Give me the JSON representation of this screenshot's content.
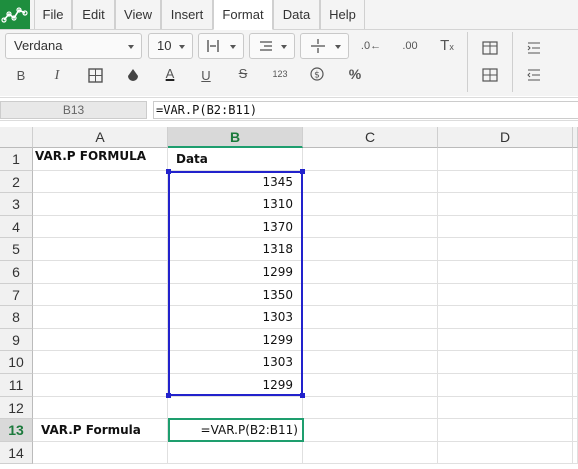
{
  "menu": [
    "File",
    "Edit",
    "View",
    "Insert",
    "Format",
    "Data",
    "Help"
  ],
  "menu_active": "Format",
  "toolbar": {
    "font_name": "Verdana",
    "font_size": "10",
    "bold": "B",
    "italic": "I",
    "text_color_glyph": "A",
    "underline": "U",
    "strike": "S",
    "number_format": "123",
    "percent": "%"
  },
  "name_box": "B13",
  "formula_bar": "=VAR.P(B2:B11)",
  "columns": [
    "A",
    "B",
    "C",
    "D"
  ],
  "rows": [
    "1",
    "2",
    "3",
    "4",
    "5",
    "6",
    "7",
    "8",
    "9",
    "10",
    "11",
    "12",
    "13",
    "14"
  ],
  "cells": {
    "A1": "VAR.P FORMULA",
    "B1": "Data",
    "B2": "1345",
    "B3": "1310",
    "B4": "1370",
    "B5": "1318",
    "B6": "1299",
    "B7": "1350",
    "B8": "1303",
    "B9": "1299",
    "B10": "1303",
    "B11": "1299",
    "A13": "VAR.P Formula",
    "B13": "=VAR.P(B2:B11)"
  },
  "colors": {
    "accent": "#1e9e6e",
    "selection": "#2222cc",
    "logo": "#1e8e3e"
  }
}
